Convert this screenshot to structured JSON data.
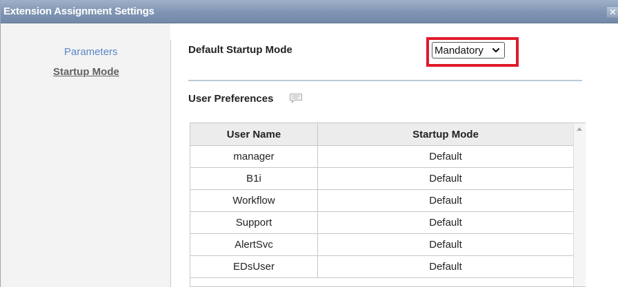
{
  "dialog": {
    "title": "Extension Assignment Settings",
    "close_glyph": "✕"
  },
  "nav": {
    "items": [
      {
        "label": "Parameters",
        "active": false
      },
      {
        "label": "Startup Mode",
        "active": true
      }
    ]
  },
  "startup": {
    "label": "Default Startup Mode",
    "selected": "Mandatory",
    "highlight_color": "#e0192c"
  },
  "preferences": {
    "label": "User Preferences",
    "icon": "comment-icon",
    "columns": [
      "User Name",
      "Startup Mode"
    ],
    "rows": [
      {
        "user": "manager",
        "mode": "Default"
      },
      {
        "user": "B1i",
        "mode": "Default"
      },
      {
        "user": "Workflow",
        "mode": "Default"
      },
      {
        "user": "Support",
        "mode": "Default"
      },
      {
        "user": "AlertSvc",
        "mode": "Default"
      },
      {
        "user": "EDsUser",
        "mode": "Default"
      }
    ]
  }
}
